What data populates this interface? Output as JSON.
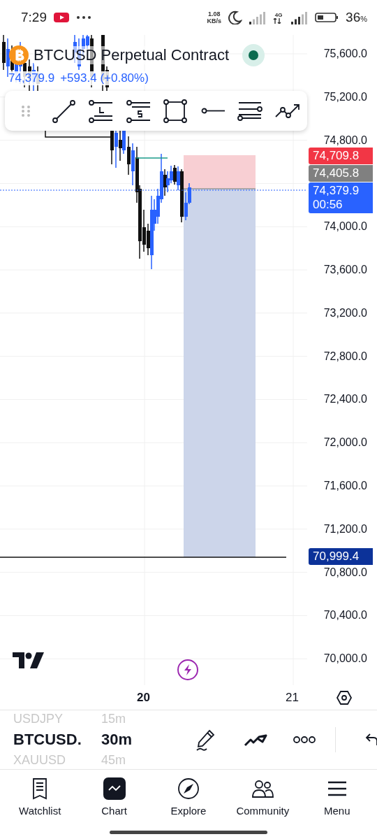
{
  "status_bar": {
    "time": "7:29",
    "net_speed_value": "1.08",
    "net_speed_unit": "KB/s",
    "network": "4G",
    "battery": "36",
    "battery_unit": "%"
  },
  "chart": {
    "symbol_title": "BTCUSD Perpetual Contract",
    "last_price": "74,379.9",
    "change": "+593.4 (+0.80%)",
    "price_axis": [
      "75,600.0",
      "75,200.0",
      "74,800.0",
      "74,000.0",
      "73,600.0",
      "73,200.0",
      "72,800.0",
      "72,400.0",
      "72,000.0",
      "71,600.0",
      "71,200.0",
      "70,800.0",
      "70,400.0",
      "70,000.0"
    ],
    "price_badges": [
      {
        "kind": "stack",
        "label": "74,709.8",
        "color": "#f23645"
      },
      {
        "kind": "stack",
        "label": "74,405.8",
        "color": "#808080"
      },
      {
        "kind": "stack",
        "label": "74,379.9",
        "sub": "00:56",
        "color": "#2962ff"
      },
      {
        "kind": "low",
        "label": "70,999.4",
        "color": "#0c3299"
      }
    ],
    "time_axis": [
      {
        "label": "20",
        "emphasized": true
      },
      {
        "label": "21",
        "emphasized": false
      }
    ]
  },
  "symbols": [
    {
      "symbol": "USDJPY",
      "interval": "15m",
      "selected": false
    },
    {
      "symbol": "BTCUSD.",
      "interval": "30m",
      "selected": true
    },
    {
      "symbol": "XAUUSD",
      "interval": "45m",
      "selected": false
    }
  ],
  "nav": [
    {
      "label": "Watchlist",
      "selected": false
    },
    {
      "label": "Chart",
      "selected": true
    },
    {
      "label": "Explore",
      "selected": false
    },
    {
      "label": "Community",
      "selected": false
    },
    {
      "label": "Menu",
      "selected": false
    }
  ]
}
